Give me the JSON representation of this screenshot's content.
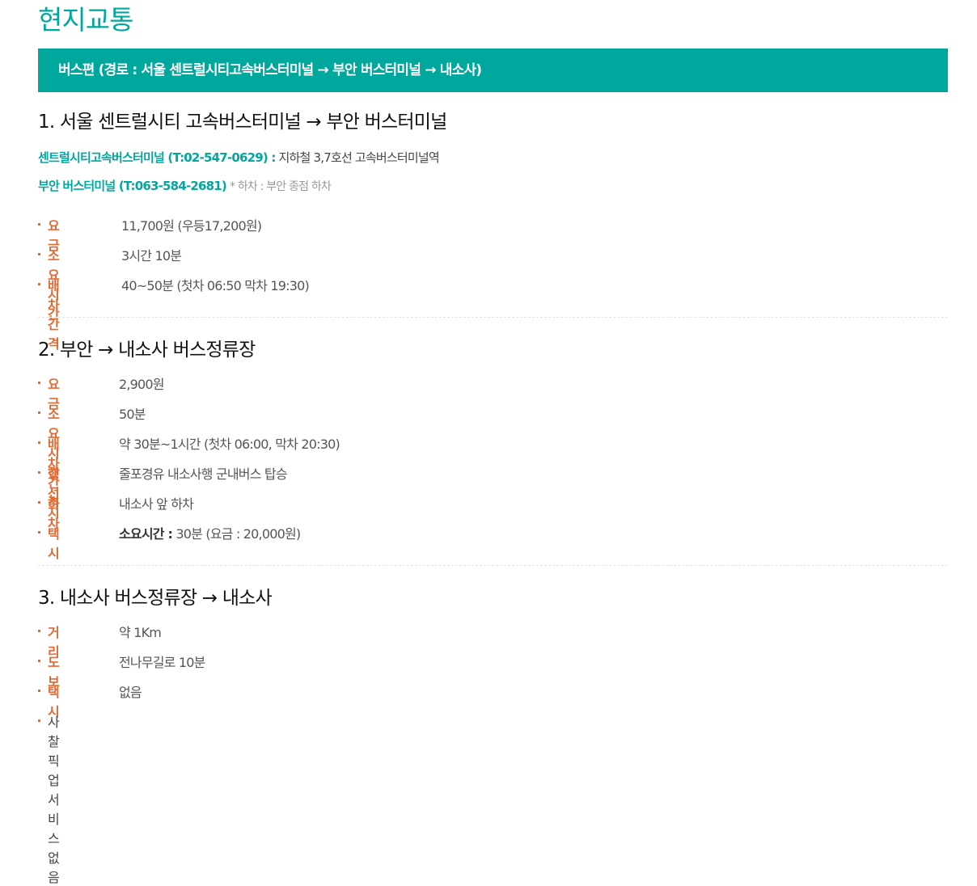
{
  "page_title": "현지교통",
  "banner": "버스편 (경로 : 서울 센트럴시티고속버스터미널 → 부안 버스터미널 → 내소사)",
  "section1": {
    "title": "1. 서울 센트럴시티 고속버스터미널 → 부안 버스터미널",
    "terminal1": {
      "name": "센트럴시티고속버스터미널 (T:02-547-0629) :",
      "info": "지하철 3,7호선 고속버스터미널역"
    },
    "terminal2": {
      "name": "부안 버스터미널 (T:063-584-2681)",
      "note": "* 하차 : 부안 종점 하차"
    },
    "items": [
      {
        "label": "요금",
        "value": "11,700원 (우등17,200원)"
      },
      {
        "label": "소요시간",
        "value": "3시간 10분"
      },
      {
        "label": "배차간격",
        "value": "40~50분 (첫차 06:50 막차 19:30)"
      }
    ]
  },
  "section2": {
    "title": "2. 부안 → 내소사 버스정류장",
    "items": [
      {
        "label": "요금",
        "value": "2,900원"
      },
      {
        "label": "소요시간",
        "value": "50분"
      },
      {
        "label": "배차간격",
        "value": "약 30분~1시간 (첫차 06:00, 막차 20:30)"
      },
      {
        "label": "행선지",
        "value": "줄포경유 내소사행 군내버스 탑승"
      },
      {
        "label": "하차",
        "value": "내소사 앞 하차"
      },
      {
        "label": "택시",
        "value_strong": "소요시간 :",
        "value": "30분 (요금 : 20,000원)"
      }
    ]
  },
  "section3": {
    "title": "3. 내소사 버스정류장 → 내소사",
    "items": [
      {
        "label": "거리",
        "value": "약 1Km"
      },
      {
        "label": "도보",
        "value": "전나무길로 10분"
      },
      {
        "label": "택시",
        "value": "없음"
      }
    ],
    "note": "사찰 픽업 서비스 없음"
  },
  "colors": {
    "accent": "#00a79d",
    "label": "#e36a32"
  }
}
